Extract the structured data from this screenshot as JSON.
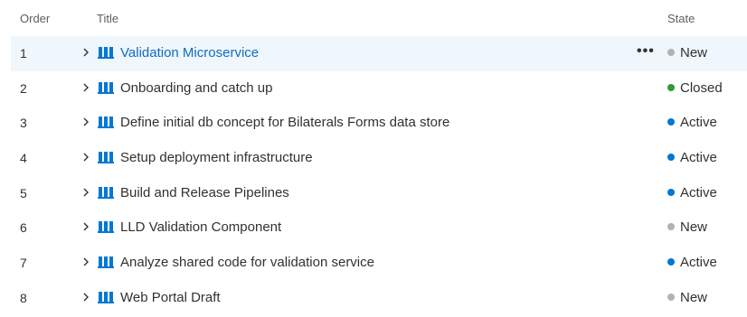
{
  "header": {
    "order_label": "Order",
    "title_label": "Title",
    "state_label": "State"
  },
  "colors": {
    "new": "#b2b2b2",
    "closed": "#339933",
    "active": "#0078d4",
    "book_icon": "#0078d4",
    "selected_row": "#eff6fc"
  },
  "rows": [
    {
      "order": "1",
      "title": "Validation Microservice",
      "state": "New",
      "state_key": "new",
      "selected": true,
      "more_label": "•••"
    },
    {
      "order": "2",
      "title": "Onboarding and catch up",
      "state": "Closed",
      "state_key": "closed"
    },
    {
      "order": "3",
      "title": "Define initial db concept for Bilaterals Forms data store",
      "state": "Active",
      "state_key": "active"
    },
    {
      "order": "4",
      "title": "Setup deployment infrastructure",
      "state": "Active",
      "state_key": "active"
    },
    {
      "order": "5",
      "title": "Build and Release Pipelines",
      "state": "Active",
      "state_key": "active"
    },
    {
      "order": "6",
      "title": "LLD Validation Component",
      "state": "New",
      "state_key": "new"
    },
    {
      "order": "7",
      "title": "Analyze shared code for validation service",
      "state": "Active",
      "state_key": "active"
    },
    {
      "order": "8",
      "title": "Web Portal Draft",
      "state": "New",
      "state_key": "new"
    }
  ]
}
